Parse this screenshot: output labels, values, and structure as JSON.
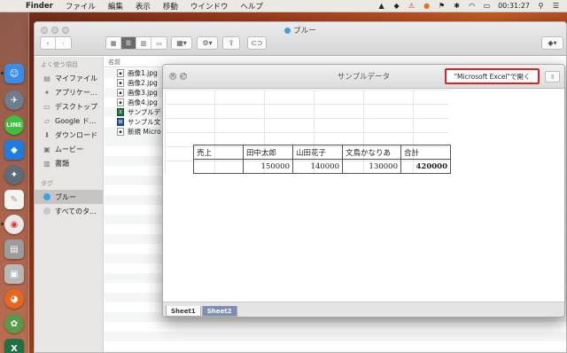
{
  "menubar": {
    "app_name": "Finder",
    "items": [
      "ファイル",
      "編集",
      "表示",
      "移動",
      "ウインドウ",
      "ヘルプ"
    ],
    "time": "00:31:27"
  },
  "finder": {
    "title": "ブルー",
    "sidebar": {
      "favorites_heading": "よく使う項目",
      "favorites": [
        {
          "label": "マイファイル",
          "icon": "my-files-icon"
        },
        {
          "label": "アプリケー...",
          "icon": "applications-icon"
        },
        {
          "label": "デスクトップ",
          "icon": "desktop-icon"
        },
        {
          "label": "Google ド...",
          "icon": "google-drive-icon"
        },
        {
          "label": "ダウンロード",
          "icon": "downloads-icon"
        },
        {
          "label": "ムービー",
          "icon": "movies-icon"
        },
        {
          "label": "書類",
          "icon": "documents-icon"
        }
      ],
      "tags_heading": "タグ",
      "tags": [
        {
          "label": "ブルー",
          "color": "#3aa0e8"
        },
        {
          "label": "すべてのタ...",
          "color": "#c8c8c8"
        }
      ]
    },
    "column_header": "名前",
    "files": [
      {
        "name": "画像1.jpg",
        "type": "image"
      },
      {
        "name": "画像2.jpg",
        "type": "image"
      },
      {
        "name": "画像3.jpg",
        "type": "image"
      },
      {
        "name": "画像4.jpg",
        "type": "image"
      },
      {
        "name": "サンプルデ",
        "type": "excel"
      },
      {
        "name": "サンプル文",
        "type": "word"
      },
      {
        "name": "新規 Micro",
        "type": "word"
      }
    ]
  },
  "quicklook": {
    "title": "サンプルデータ",
    "open_button": "\"Microsoft Excel\"で開く",
    "table": {
      "headers": [
        "売上",
        "田中太郎",
        "山田花子",
        "文鳥かなりあ",
        "合計"
      ],
      "row": [
        "",
        "150000",
        "140000",
        "130000",
        "420000"
      ]
    },
    "sheets": [
      "Sheet1",
      "Sheet2"
    ]
  }
}
